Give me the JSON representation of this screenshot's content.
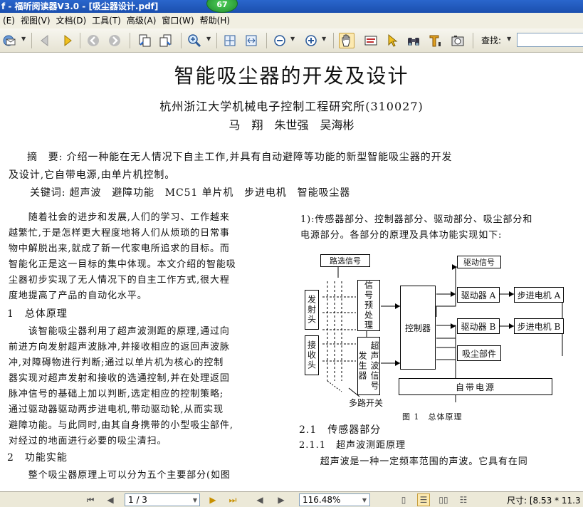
{
  "window": {
    "title": "f - 福昕阅读器V3.0 - [吸尘器设计.pdf]",
    "badge": "67"
  },
  "menu": [
    "(E)",
    "视图(V)",
    "文档(D)",
    "工具(T)",
    "高级(A)",
    "窗口(W)",
    "帮助(H)"
  ],
  "toolbar": {
    "find_label": "查找:",
    "find_value": ""
  },
  "icons": [
    "email-icon",
    "back-icon",
    "forward-icon",
    "prev-view-icon",
    "next-view-icon",
    "copy-page-icon",
    "paste-page-icon",
    "zoom-in-icon",
    "fit-page-icon",
    "fit-width-icon",
    "zoom-out-minus-icon",
    "zoom-in-plus-icon",
    "hand-icon",
    "select-text-icon",
    "pointer-icon",
    "find-binoculars-icon",
    "text-tool-icon",
    "snapshot-icon"
  ],
  "doc": {
    "title": "智能吸尘器的开发及设计",
    "affiliation": "杭州浙江大学机械电子控制工程研究所(310027)",
    "authors": "马　翔　朱世强　吴海彬",
    "abstract_line1": "摘　要: 介绍一种能在无人情况下自主工作,并具有自动避障等功能的新型智能吸尘器的开发",
    "abstract_line2": "及设计,它自带电源,由单片机控制。",
    "keywords": "关键词: 超声波　避障功能　MC51 单片机　步进电机　智能吸尘器",
    "left_col": [
      "　　随着社会的进步和发展,人们的学习、工作越来",
      "越繁忙,于是怎样更大程度地将人们从烦琐的日常事",
      "物中解脱出来,就成了新一代家电所追求的目标。而",
      "智能化正是这一目标的集中体现。本文介绍的智能吸",
      "尘器初步实现了无人情况下的自主工作方式,很大程",
      "度地提高了产品的自动化水平。"
    ],
    "h1": "1　总体原理",
    "left_col2": [
      "　　该智能吸尘器利用了超声波测距的原理,通过向",
      "前进方向发射超声波脉冲,并接收相应的返回声波脉",
      "冲,对障碍物进行判断;通过以单片机为核心的控制",
      "器实现对超声发射和接收的选通控制,并在处理返回",
      "脉冲信号的基础上加以判断,选定相应的控制策略;",
      "通过驱动器驱动两步进电机,带动驱动轮,从而实现",
      "避障功能。与此同时,由其自身携带的小型吸尘部件,",
      "对经过的地面进行必要的吸尘清扫。"
    ],
    "h2": "2　功能实能",
    "left_col3": "　　整个吸尘器原理上可以分为五个主要部分(如图",
    "right_col": [
      "1):传感器部分、控制器部分、驱动部分、吸尘部分和",
      "电源部分。各部分的原理及具体功能实现如下:"
    ],
    "figure": {
      "lbl_road": "路选信号",
      "lbl_drive_sig": "驱动信号",
      "emit": "发射头",
      "recv": "接收头",
      "sigproc": "信号预处理",
      "ultra": "超声波信号发生器",
      "controller": "控制器",
      "driverA": "驱动器 A",
      "driverB": "驱动器 B",
      "motorA": "步进电机 A",
      "motorB": "步进电机 B",
      "vacuum": "吸尘部件",
      "power": "自带电源",
      "multi_switch": "多路开关",
      "caption": "图 1　总体原理"
    },
    "h21": "2.1　传感器部分",
    "h211": "2.1.1　超声波测距原理",
    "right_last": "　　超声波是一种一定频率范围的声波。它具有在同"
  },
  "status": {
    "page": "1 / 3",
    "zoom": "116.48%",
    "size": "尺寸: [8.53 * 11.3"
  }
}
